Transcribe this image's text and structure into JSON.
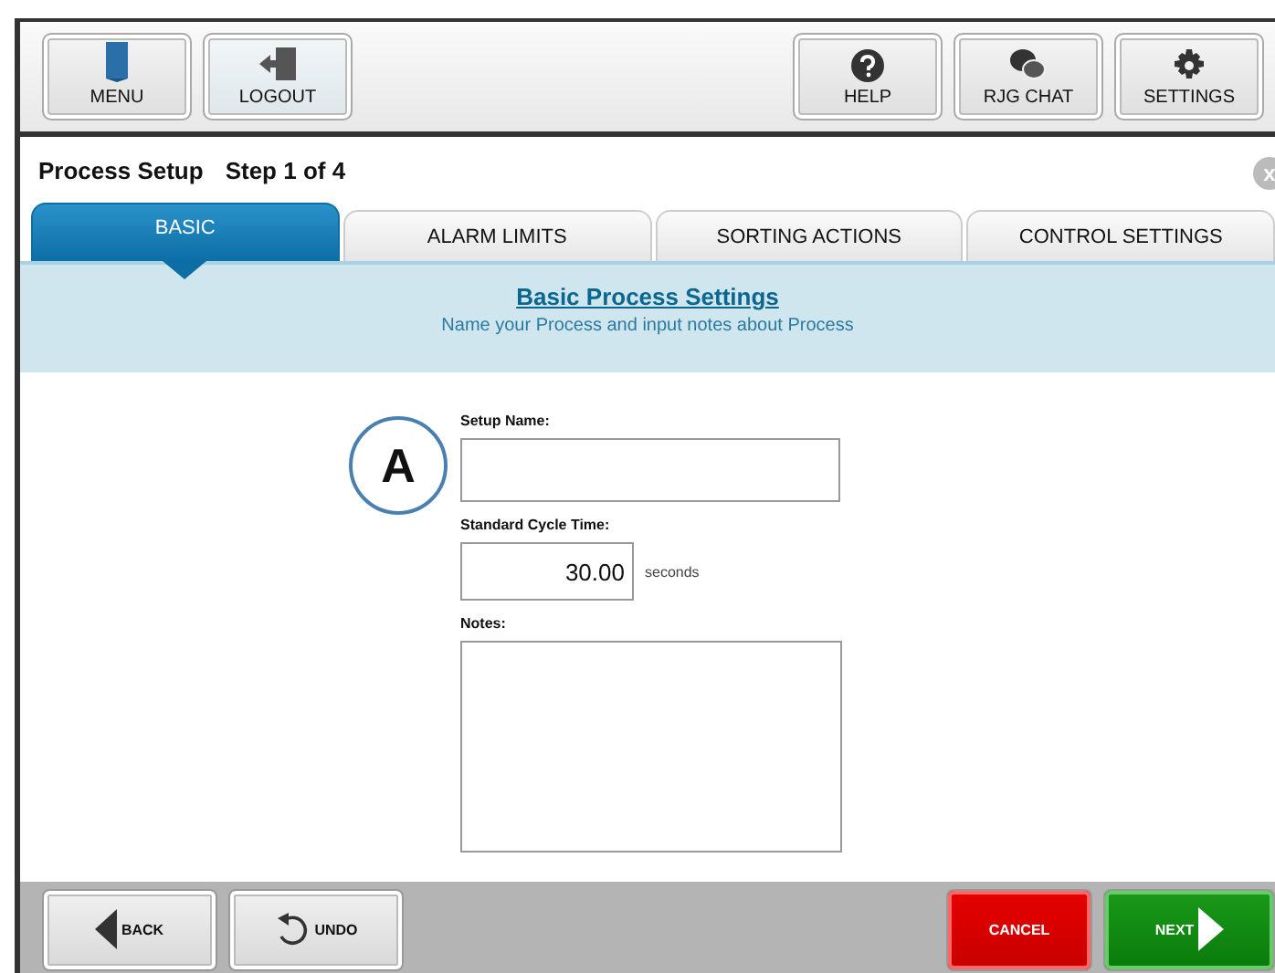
{
  "toolbar": {
    "left": [
      {
        "label": "MENU",
        "kind": "menu"
      },
      {
        "label": "LOGOUT",
        "kind": "logout"
      }
    ],
    "right": [
      {
        "label": "HELP",
        "kind": "help"
      },
      {
        "label": "RJG CHAT",
        "kind": "chat"
      },
      {
        "label": "SETTINGS",
        "kind": "settings"
      }
    ]
  },
  "header": {
    "title": "Process Setup",
    "step": "Step 1 of 4",
    "close": "x"
  },
  "tabs": [
    {
      "label": "BASIC",
      "selected": true
    },
    {
      "label": "ALARM LIMITS",
      "selected": false
    },
    {
      "label": "SORTING ACTIONS",
      "selected": false
    },
    {
      "label": "CONTROL SETTINGS",
      "selected": false
    }
  ],
  "banner": {
    "title": "Basic Process Settings",
    "subtitle": "Name your Process and input notes about Process"
  },
  "callout": "A",
  "form": {
    "setup_name": {
      "label": "Setup Name:"
    },
    "cycle_time": {
      "label": "Standard Cycle Time:",
      "value": "30.00",
      "unit": "seconds"
    },
    "notes": {
      "label": "Notes:"
    }
  },
  "footer": {
    "left": [
      {
        "label": "BACK",
        "kind": "back"
      },
      {
        "label": "UNDO",
        "kind": "undo"
      }
    ],
    "right": [
      {
        "label": "CANCEL",
        "kind": "cancel"
      },
      {
        "label": "NEXT",
        "kind": "next"
      }
    ]
  }
}
